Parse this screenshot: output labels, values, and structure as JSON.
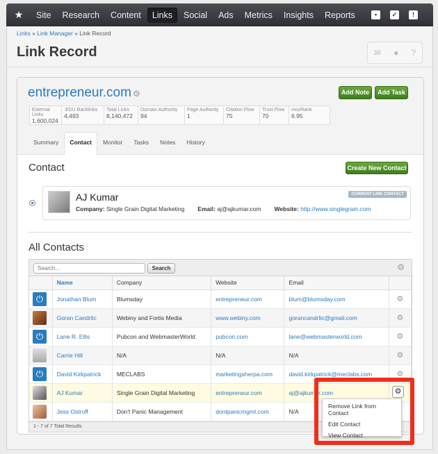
{
  "topnav": {
    "items": [
      "Site",
      "Research",
      "Content",
      "Links",
      "Social",
      "Ads",
      "Metrics",
      "Insights",
      "Reports"
    ],
    "active": "Links"
  },
  "breadcrumb": {
    "link1": "Links",
    "link2": "Link Manager",
    "current": "Link Record"
  },
  "page_title": "Link Record",
  "record": {
    "domain": "entrepreneur.com",
    "add_note": "Add Note",
    "add_task": "Add Task",
    "metrics": [
      {
        "label": "External Links",
        "value": "1,600,024"
      },
      {
        "label": ".EDU Backlinks",
        "value": "4,493"
      },
      {
        "label": "Total Links",
        "value": "8,140,472"
      },
      {
        "label": "Domain Authority",
        "value": "94"
      },
      {
        "label": "Page Authority",
        "value": "1"
      },
      {
        "label": "Citation Flow",
        "value": "75"
      },
      {
        "label": "Trust Flow",
        "value": "70"
      },
      {
        "label": "mozRank",
        "value": "6.95"
      }
    ],
    "tabs": [
      "Summary",
      "Contact",
      "Monitor",
      "Tasks",
      "Notes",
      "History"
    ],
    "active_tab": "Contact"
  },
  "contact": {
    "section_title": "Contact",
    "create_button": "Create New Contact",
    "name": "AJ Kumar",
    "badge": "CURRENT LINK CONTACT",
    "company_label": "Company:",
    "company": "Single Grain Digital Marketing",
    "email_label": "Email:",
    "email": "aj@ajkumar.com",
    "website_label": "Website:",
    "website": "http://www.singlegrain.com"
  },
  "all_contacts": {
    "section_title": "All Contacts",
    "search_placeholder": "Search...",
    "search_button": "Search",
    "columns": [
      "Name",
      "Company",
      "Website",
      "Email"
    ],
    "rows": [
      {
        "name": "Jonathan Blum",
        "company": "Blumsday",
        "website": "entrepreneur.com",
        "email": "blum@blumsday.com"
      },
      {
        "name": "Goran Candrlic",
        "company": "Webiny and Fortis Media",
        "website": "www.webiny.com",
        "email": "gorancandrlic@gmail.com"
      },
      {
        "name": "Lane R. Ellis",
        "company": "Pubcon and WebmasterWorld",
        "website": "pubcon.com",
        "email": "lane@webmasterworld.com"
      },
      {
        "name": "Carrie Hill",
        "company": "N/A",
        "website": "N/A",
        "email": "N/A"
      },
      {
        "name": "David Kirkpatrick",
        "company": "MECLABS",
        "website": "marketingsherpa.com",
        "email": "david.kirkpatrick@meclabs.com"
      },
      {
        "name": "AJ Kumar",
        "company": "Single Grain Digital Marketing",
        "website": "entrepreneur.com",
        "email": "aj@ajkumar.com"
      },
      {
        "name": "Jess Ostroff",
        "company": "Don't Panic Management",
        "website": "dontpanicmgmt.com",
        "email": "N/A"
      }
    ],
    "footer": "1 - 7 of 7 Total Results"
  },
  "popup_menu": [
    "Remove Link from Contact",
    "Edit Contact",
    "View Contact"
  ],
  "colors": {
    "accent": "#2a7bbf",
    "green": "#4f8f2a",
    "highlight_box": "#f22d1a"
  }
}
